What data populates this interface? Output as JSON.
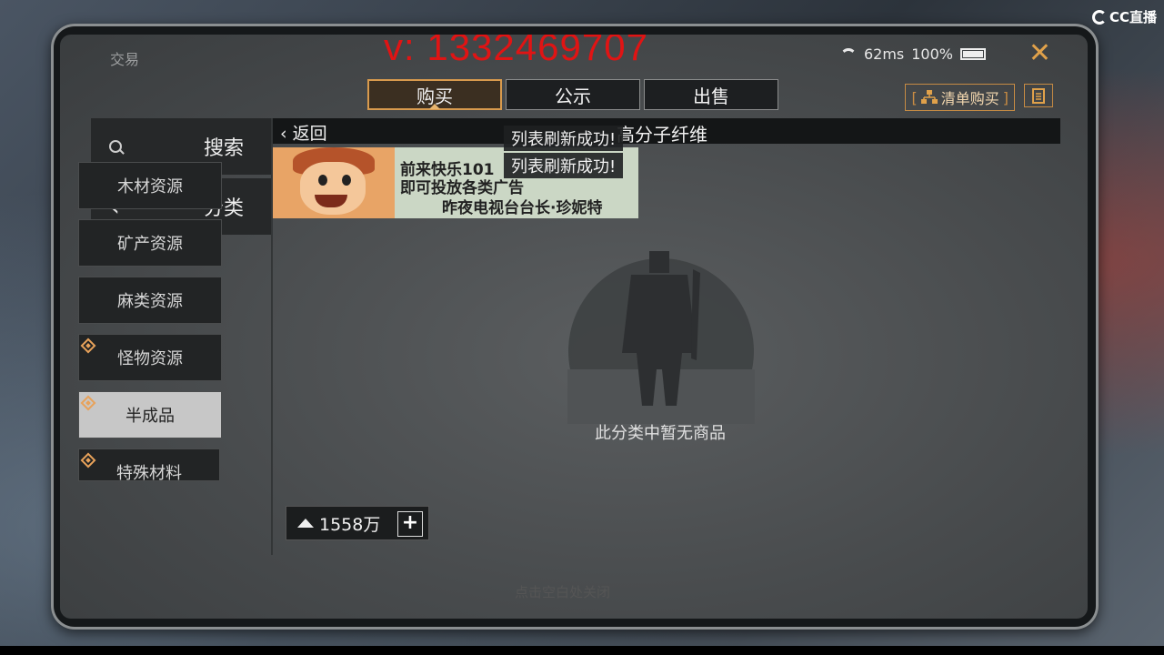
{
  "overlay": {
    "watermark": "v: 1332469707",
    "stream_logo": "CC直播"
  },
  "window": {
    "title": "交易",
    "ping": "62ms",
    "battery": "100%",
    "close_label": "✕"
  },
  "tabs": [
    {
      "label": "购买",
      "active": true
    },
    {
      "label": "公示",
      "active": false
    },
    {
      "label": "出售",
      "active": false
    }
  ],
  "toolbar": {
    "list_buy_label": "清单购买",
    "clipboard_icon": "clipboard-icon"
  },
  "sidebar": {
    "search_label": "搜索",
    "category_label": "分类",
    "items": [
      {
        "label": "木材资源",
        "marked": false,
        "active": false
      },
      {
        "label": "矿产资源",
        "marked": false,
        "active": false
      },
      {
        "label": "麻类资源",
        "marked": false,
        "active": false
      },
      {
        "label": "怪物资源",
        "marked": true,
        "active": false
      },
      {
        "label": "半成品",
        "marked": true,
        "active": true
      },
      {
        "label": "特殊材料",
        "marked": true,
        "active": false
      }
    ]
  },
  "content": {
    "back_label": "返回",
    "category_title": "高分子纤维",
    "toasts": [
      "列表刷新成功!",
      "列表刷新成功!"
    ],
    "banner": {
      "line1": "前来快乐101",
      "line2": "即可投放各类广告",
      "line3": "昨夜电视台台长·珍妮特"
    },
    "empty_text": "此分类中暂无商品"
  },
  "wallet": {
    "amount": "1558万",
    "add_label": "+"
  },
  "footer": {
    "close_hint": "点击空白处关闭"
  },
  "colors": {
    "accent": "#d89a4d",
    "watermark": "#e01414"
  }
}
